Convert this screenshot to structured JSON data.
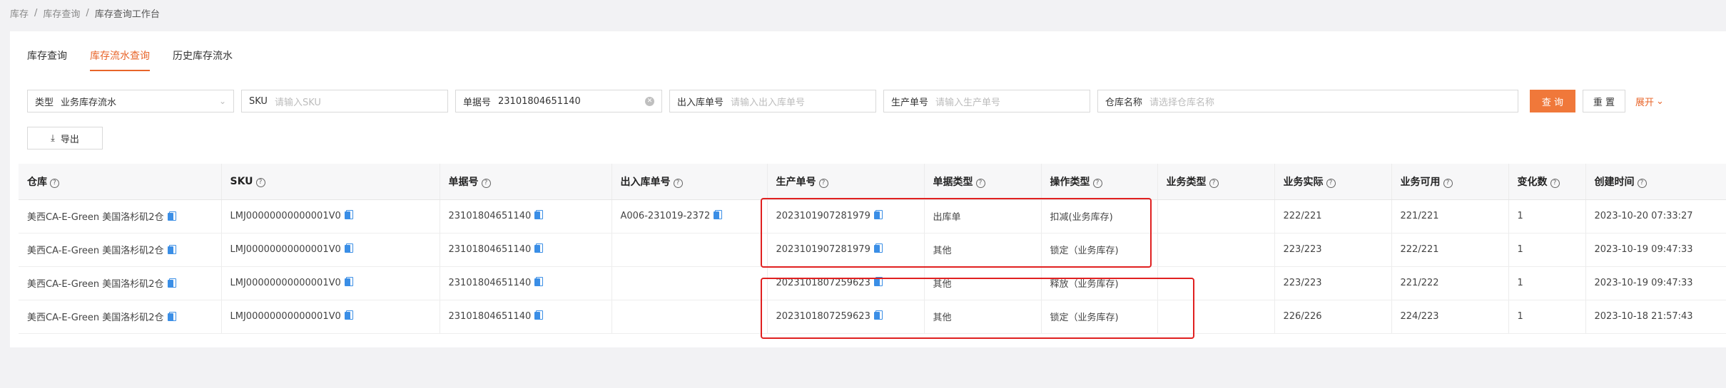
{
  "breadcrumb": {
    "items": [
      "库存",
      "/",
      "库存查询",
      "/",
      "库存查询工作台"
    ]
  },
  "tabs": [
    {
      "label": "库存查询",
      "active": false
    },
    {
      "label": "库存流水查询",
      "active": true
    },
    {
      "label": "历史库存流水",
      "active": false
    }
  ],
  "filters": {
    "type": {
      "label": "类型",
      "value": "业务库存流水"
    },
    "sku": {
      "label": "SKU",
      "placeholder": "请输入SKU"
    },
    "doc_no": {
      "label": "单据号",
      "value": "23101804651140"
    },
    "inout_no": {
      "label": "出入库单号",
      "placeholder": "请输入出入库单号"
    },
    "prod_no": {
      "label": "生产单号",
      "placeholder": "请输入生产单号"
    },
    "warehouse": {
      "label": "仓库名称",
      "placeholder": "请选择仓库名称"
    }
  },
  "buttons": {
    "query": "查 询",
    "reset": "重 置",
    "expand": "展开",
    "export": "导出"
  },
  "table": {
    "columns": [
      "仓库",
      "SKU",
      "单据号",
      "出入库单号",
      "生产单号",
      "单据类型",
      "操作类型",
      "业务类型",
      "业务实际",
      "业务可用",
      "变化数",
      "创建时间"
    ],
    "rows": [
      [
        "美西CA-E-Green 美国洛杉矶2仓",
        "LMJ00000000000001V0",
        "23101804651140",
        "A006-231019-2372",
        "2023101907281979",
        "出库单",
        "扣减(业务库存)",
        "",
        "222/221",
        "221/221",
        "1",
        "2023-10-20 07:33:27"
      ],
      [
        "美西CA-E-Green 美国洛杉矶2仓",
        "LMJ00000000000001V0",
        "23101804651140",
        "",
        "2023101907281979",
        "其他",
        "锁定（业务库存)",
        "",
        "223/223",
        "222/221",
        "1",
        "2023-10-19 09:47:33"
      ],
      [
        "美西CA-E-Green 美国洛杉矶2仓",
        "LMJ00000000000001V0",
        "23101804651140",
        "",
        "2023101807259623",
        "其他",
        "释放（业务库存)",
        "",
        "223/223",
        "221/222",
        "1",
        "2023-10-19 09:47:33"
      ],
      [
        "美西CA-E-Green 美国洛杉矶2仓",
        "LMJ00000000000001V0",
        "23101804651140",
        "",
        "2023101807259623",
        "其他",
        "锁定（业务库存)",
        "",
        "226/226",
        "224/223",
        "1",
        "2023-10-18 21:57:43"
      ]
    ]
  },
  "colors": {
    "accent": "#e8652a",
    "primary_button": "#f0783a",
    "highlight_box": "#e02020",
    "copy_icon": "#3a8ee6"
  }
}
